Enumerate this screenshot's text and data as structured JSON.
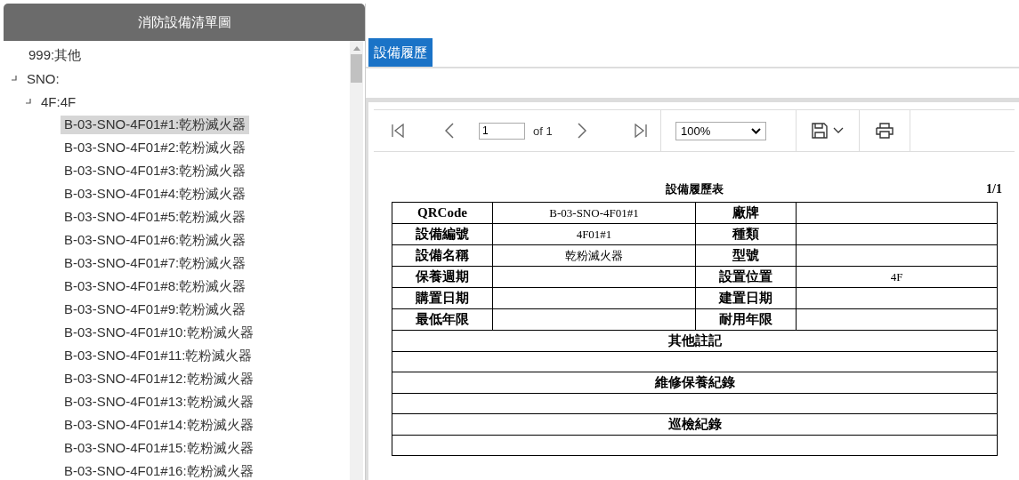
{
  "sidebar": {
    "title": "消防設備清單圖",
    "tree": [
      {
        "label": "999:其他",
        "selected": false
      },
      {
        "label": "SNO:",
        "expanded": true,
        "selected": false,
        "children": [
          {
            "label": "4F:4F",
            "expanded": true,
            "selected": false,
            "children": [
              {
                "label": "B-03-SNO-4F01#1:乾粉滅火器",
                "selected": true
              },
              {
                "label": "B-03-SNO-4F01#2:乾粉滅火器",
                "selected": false
              },
              {
                "label": "B-03-SNO-4F01#3:乾粉滅火器",
                "selected": false
              },
              {
                "label": "B-03-SNO-4F01#4:乾粉滅火器",
                "selected": false
              },
              {
                "label": "B-03-SNO-4F01#5:乾粉滅火器",
                "selected": false
              },
              {
                "label": "B-03-SNO-4F01#6:乾粉滅火器",
                "selected": false
              },
              {
                "label": "B-03-SNO-4F01#7:乾粉滅火器",
                "selected": false
              },
              {
                "label": "B-03-SNO-4F01#8:乾粉滅火器",
                "selected": false
              },
              {
                "label": "B-03-SNO-4F01#9:乾粉滅火器",
                "selected": false
              },
              {
                "label": "B-03-SNO-4F01#10:乾粉滅火器",
                "selected": false
              },
              {
                "label": "B-03-SNO-4F01#11:乾粉滅火器",
                "selected": false
              },
              {
                "label": "B-03-SNO-4F01#12:乾粉滅火器",
                "selected": false
              },
              {
                "label": "B-03-SNO-4F01#13:乾粉滅火器",
                "selected": false
              },
              {
                "label": "B-03-SNO-4F01#14:乾粉滅火器",
                "selected": false
              },
              {
                "label": "B-03-SNO-4F01#15:乾粉滅火器",
                "selected": false
              },
              {
                "label": "B-03-SNO-4F01#16:乾粉滅火器",
                "selected": false
              }
            ]
          }
        ]
      }
    ]
  },
  "tabs": [
    {
      "label": "設備履歷",
      "selected": true
    }
  ],
  "toolbar": {
    "page": "1",
    "page_count": "of 1",
    "zoom": "100%"
  },
  "report": {
    "title": "設備履歷表",
    "page_indicator": "1/1",
    "rows": [
      {
        "kind": "fields",
        "cells": [
          {
            "kind": "label",
            "text": "QRCode"
          },
          {
            "kind": "value",
            "text": "B-03-SNO-4F01#1"
          },
          {
            "kind": "label",
            "text": "廠牌"
          },
          {
            "kind": "value",
            "text": ""
          }
        ]
      },
      {
        "kind": "fields",
        "cells": [
          {
            "kind": "label",
            "text": "設備編號"
          },
          {
            "kind": "value",
            "text": "4F01#1"
          },
          {
            "kind": "label",
            "text": "種類"
          },
          {
            "kind": "value",
            "text": ""
          }
        ]
      },
      {
        "kind": "fields",
        "cells": [
          {
            "kind": "label",
            "text": "設備名稱"
          },
          {
            "kind": "value",
            "text": "乾粉滅火器"
          },
          {
            "kind": "label",
            "text": "型號"
          },
          {
            "kind": "value",
            "text": ""
          }
        ]
      },
      {
        "kind": "fields",
        "cells": [
          {
            "kind": "label",
            "text": "保養週期"
          },
          {
            "kind": "value",
            "text": ""
          },
          {
            "kind": "label",
            "text": "設置位置"
          },
          {
            "kind": "value",
            "text": "4F"
          }
        ]
      },
      {
        "kind": "fields",
        "cells": [
          {
            "kind": "label",
            "text": "購置日期"
          },
          {
            "kind": "value",
            "text": ""
          },
          {
            "kind": "label",
            "text": "建置日期"
          },
          {
            "kind": "value",
            "text": ""
          }
        ]
      },
      {
        "kind": "fields",
        "cells": [
          {
            "kind": "label",
            "text": "最低年限"
          },
          {
            "kind": "value",
            "text": ""
          },
          {
            "kind": "label",
            "text": "耐用年限"
          },
          {
            "kind": "value",
            "text": ""
          }
        ]
      },
      {
        "kind": "section",
        "text": "其他註記"
      },
      {
        "kind": "blank"
      },
      {
        "kind": "section",
        "text": "維修保養紀錄"
      },
      {
        "kind": "blank"
      },
      {
        "kind": "section",
        "text": "巡檢紀錄"
      },
      {
        "kind": "blank"
      }
    ]
  }
}
